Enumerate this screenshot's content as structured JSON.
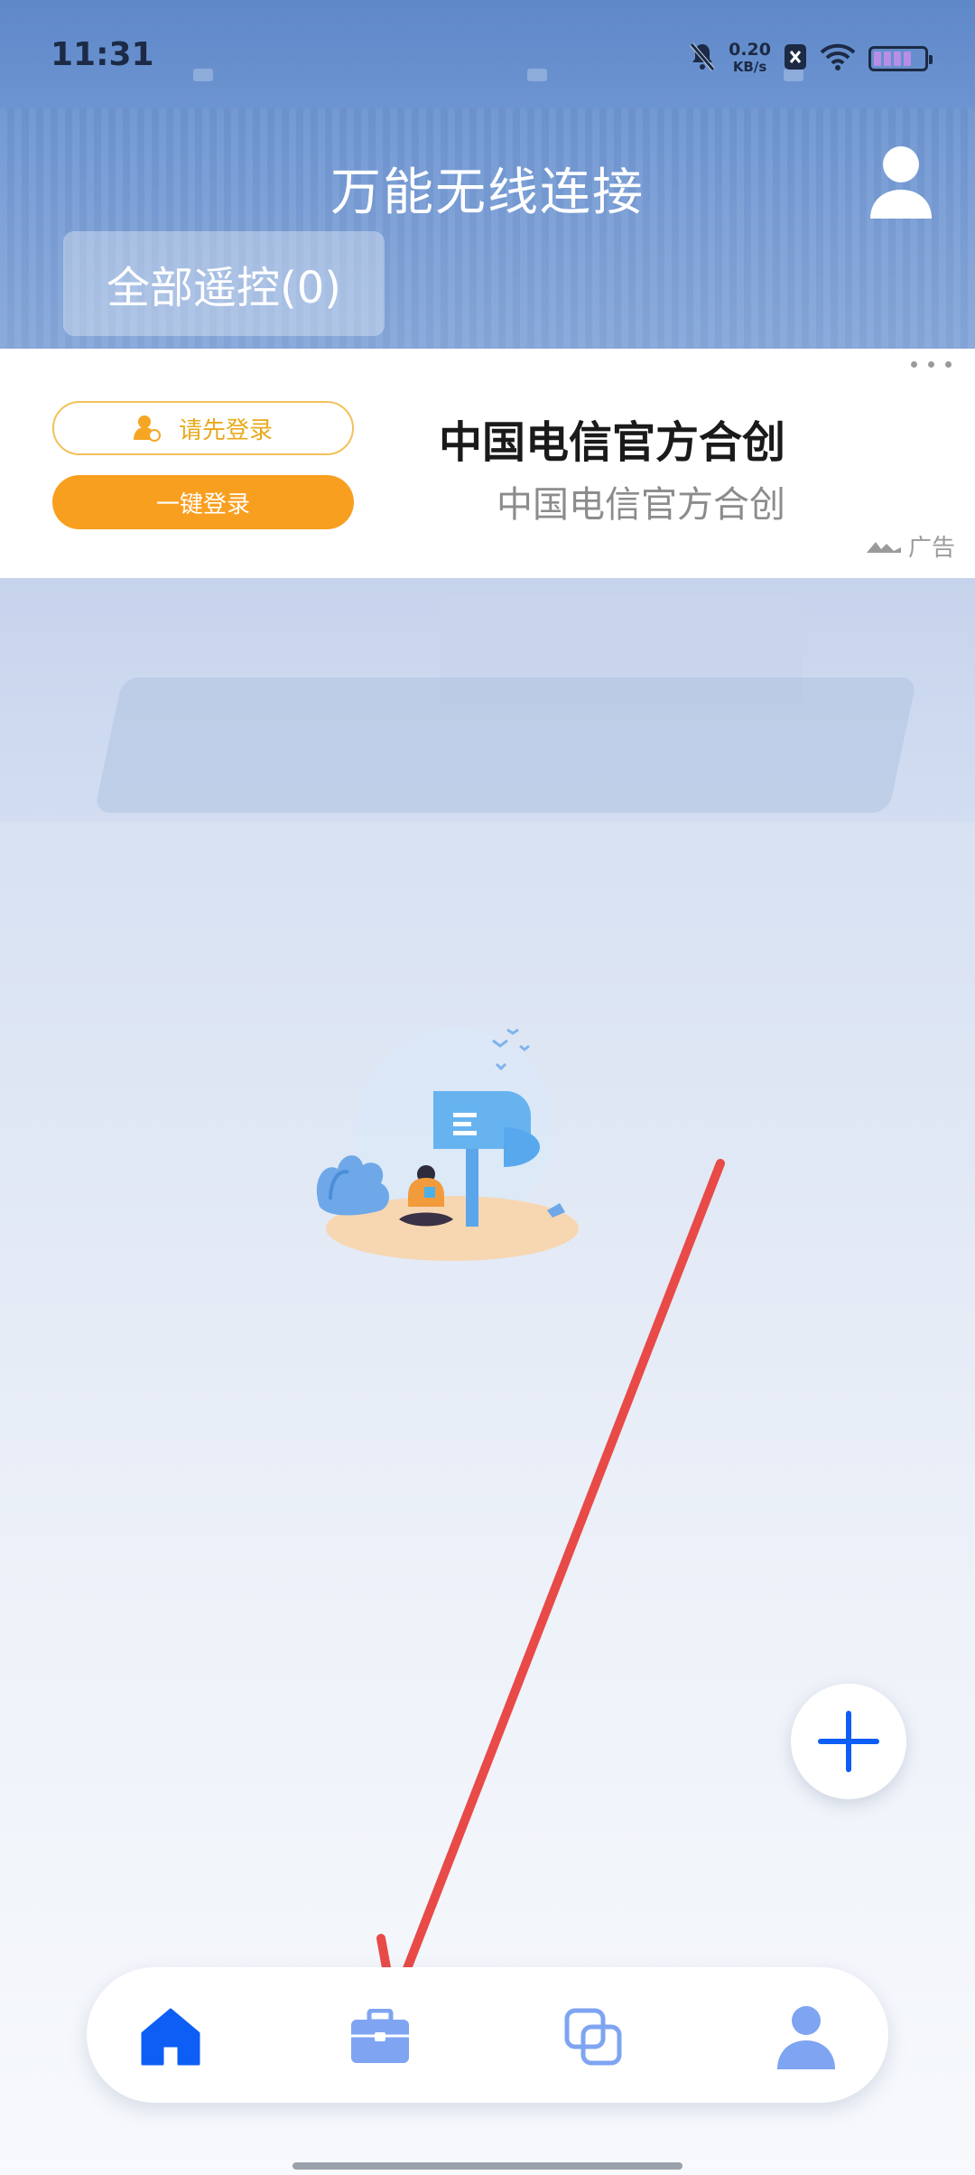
{
  "status_bar": {
    "time": "11:31",
    "net_speed_value": "0.20",
    "net_speed_unit": "KB/s",
    "battery_level": 0.45
  },
  "header": {
    "title": "万能无线连接",
    "tab_all_label": "全部遥控(0)"
  },
  "ad": {
    "login_prompt": "请先登录",
    "login_button": "一键登录",
    "title": "中国电信官方合创",
    "subtitle": "中国电信官方合创",
    "tag": "广告"
  },
  "bottom_nav": {
    "items": [
      {
        "icon": "home-icon",
        "active": true
      },
      {
        "icon": "toolbox-icon",
        "active": false
      },
      {
        "icon": "devices-icon",
        "active": false
      },
      {
        "icon": "profile-icon",
        "active": false
      }
    ]
  },
  "colors": {
    "accent": "#0c5ef5",
    "orange": "#f99f1f",
    "nav_inactive": "#7ea4f2",
    "annotation": "#e84a48"
  }
}
